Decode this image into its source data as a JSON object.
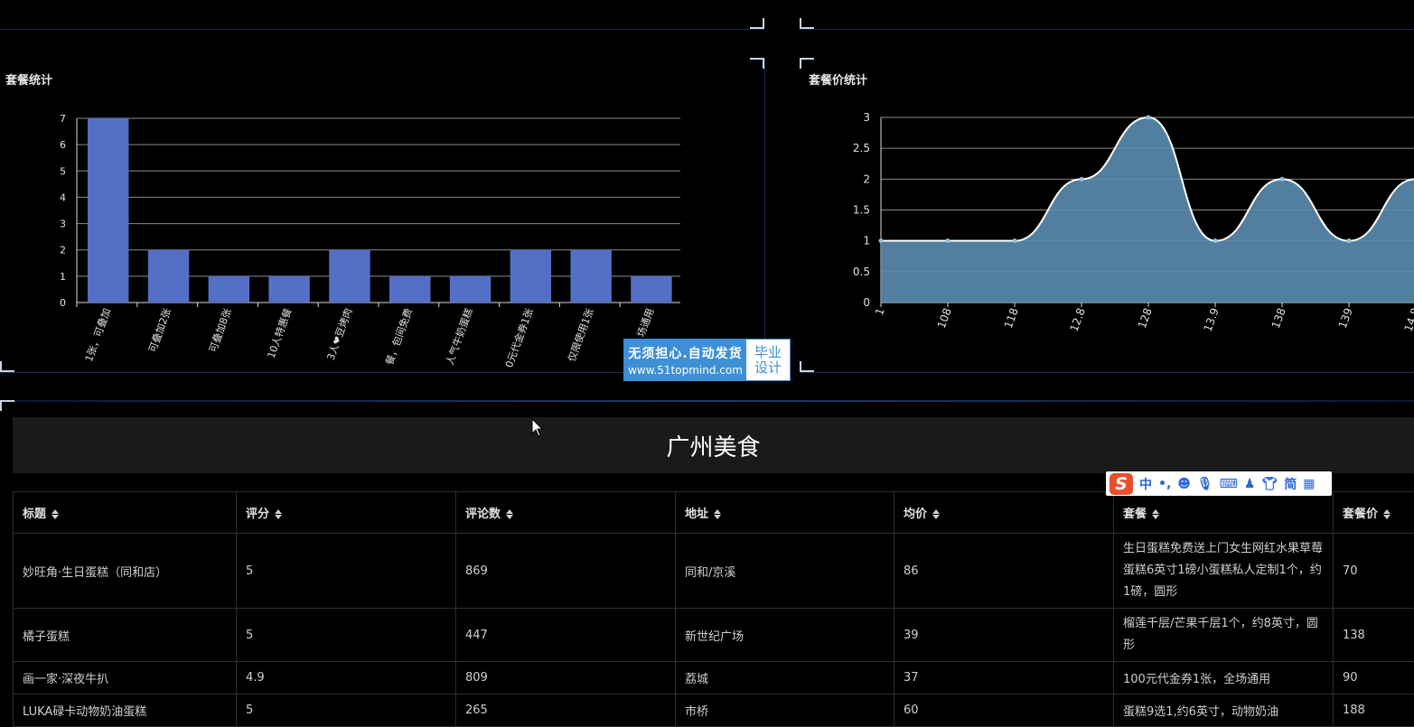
{
  "left_panel": {
    "title": "套餐统计",
    "chart_data": {
      "type": "bar",
      "title": "",
      "categories": [
        "1张，可叠加",
        "可叠加2张",
        "可叠加8张",
        "10人特惠餐",
        "3人❤豆烤肉",
        "餐，包间免费",
        "人气牛奶蛋糕",
        "0元代金券1张",
        "仅限使用1张",
        "场通用"
      ],
      "values": [
        7,
        2,
        1,
        1,
        2,
        1,
        1,
        2,
        2,
        1
      ],
      "ylim": [
        0,
        7
      ],
      "yticks": [
        0,
        1,
        2,
        3,
        4,
        5,
        6,
        7
      ],
      "grid": true,
      "bar_color": "#5470c6"
    }
  },
  "right_panel": {
    "title": "套餐价统计",
    "chart_data": {
      "type": "area",
      "title": "",
      "categories": [
        "1",
        "108",
        "118",
        "12.8",
        "128",
        "13.9",
        "138",
        "139",
        "14.8"
      ],
      "values": [
        1,
        1,
        1,
        2,
        3,
        1,
        2,
        1,
        2
      ],
      "ylim": [
        0,
        3
      ],
      "yticks": [
        "0",
        "0.5",
        "1",
        "1.5",
        "2",
        "2.5",
        "3"
      ],
      "smooth": true,
      "grid": true,
      "fill_color": "#5b8db0",
      "line_color": "#ffffff"
    }
  },
  "watermark": {
    "line1": "无须担心.自动发货",
    "line2": "www.51topmind.com",
    "badge1": "毕业",
    "badge2": "设计"
  },
  "section_title": "广州美食",
  "ime_toolbar": {
    "logo": "S",
    "mode": "中",
    "punct": "•,",
    "simplified": "简"
  },
  "table": {
    "headers": [
      "标题",
      "评分",
      "评论数",
      "地址",
      "均价",
      "套餐",
      "套餐价"
    ],
    "rows": [
      [
        "妙旺角·生日蛋糕（同和店）",
        "5",
        "869",
        "同和/京溪",
        "86",
        "生日蛋糕免费送上门女生网红水果草莓蛋糕6英寸1磅小蛋糕私人定制1个，约1磅，圆形",
        "70"
      ],
      [
        "橘子蛋糕",
        "5",
        "447",
        "新世纪广场",
        "39",
        "榴莲千层/芒果千层1个，约8英寸，圆形",
        "138"
      ],
      [
        "画一家·深夜牛扒",
        "4.9",
        "809",
        "荔城",
        "37",
        "100元代金券1张，全场通用",
        "90"
      ],
      [
        "LUKA碌卡动物奶油蛋糕",
        "5",
        "265",
        "市桥",
        "60",
        "蛋糕9选1,约6英寸，动物奶油",
        "188"
      ]
    ]
  }
}
